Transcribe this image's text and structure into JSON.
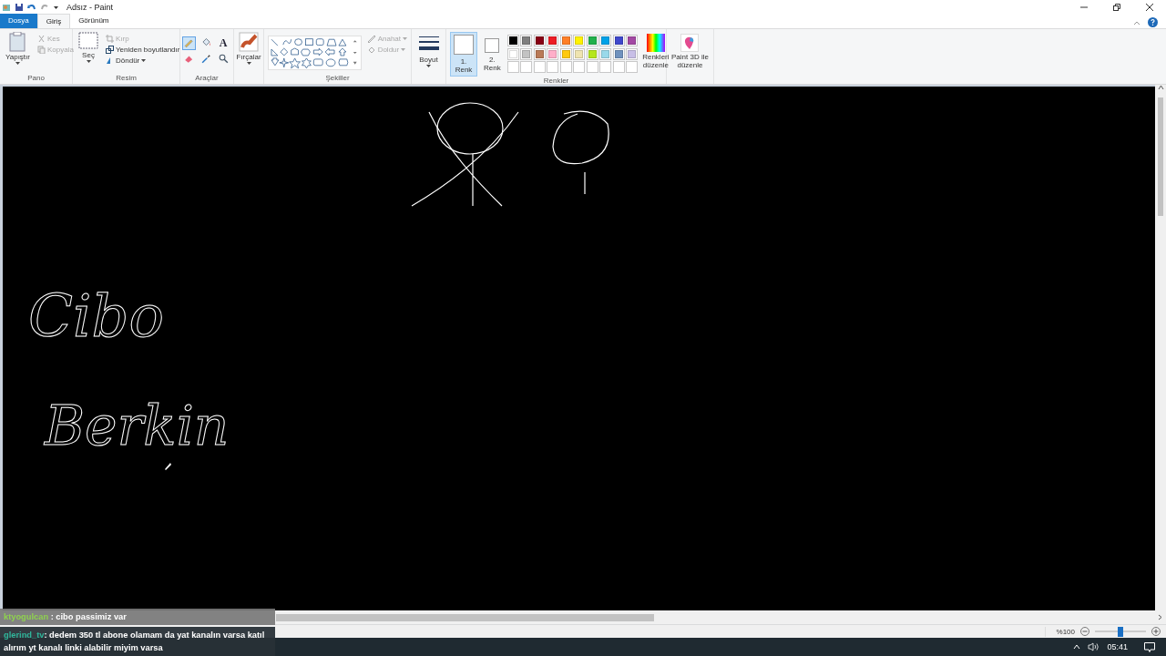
{
  "window": {
    "title": "Adsız - Paint"
  },
  "tabs": [
    {
      "label": "Dosya",
      "kind": "file",
      "selected": false
    },
    {
      "label": "Giriş",
      "kind": "tab",
      "selected": true
    },
    {
      "label": "Görünüm",
      "kind": "tab",
      "selected": false
    }
  ],
  "clipboard": {
    "label": "Pano",
    "paste": "Yapıştır",
    "cut": {
      "label": "Kes",
      "disabled": true
    },
    "copy": {
      "label": "Kopyala",
      "disabled": true
    }
  },
  "image": {
    "label": "Resim",
    "select": "Seç",
    "crop": {
      "label": "Kırp",
      "disabled": true
    },
    "resize": {
      "label": "Yeniden boyutlandır",
      "disabled": false
    },
    "rotate": {
      "label": "Döndür",
      "disabled": false
    }
  },
  "tools": {
    "label": "Araçlar",
    "items": [
      {
        "kind": "pencil",
        "selected": true
      },
      {
        "kind": "fill",
        "selected": false
      },
      {
        "kind": "text",
        "glyph": "A",
        "selected": false
      },
      {
        "kind": "eraser",
        "selected": false
      },
      {
        "kind": "picker",
        "selected": false
      },
      {
        "kind": "magnifier",
        "selected": false
      }
    ]
  },
  "brushes": "Fırçalar",
  "shapes": {
    "label": "Şekiller",
    "outline": {
      "label": "Anahat",
      "disabled": true
    },
    "fill": {
      "label": "Doldur",
      "disabled": true
    }
  },
  "size": "Boyut",
  "colors": {
    "label": "Renkler",
    "color1": {
      "label": "1. Renk",
      "color": "#ffffff",
      "selected": true
    },
    "color2": {
      "label": "2. Renk",
      "color": "#ffffff",
      "selected": false
    },
    "palette": [
      {
        "color": "#000000"
      },
      {
        "color": "#7f7f7f"
      },
      {
        "color": "#880015"
      },
      {
        "color": "#ed1c24"
      },
      {
        "color": "#ff7f27"
      },
      {
        "color": "#fff200"
      },
      {
        "color": "#22b14c"
      },
      {
        "color": "#00a2e8"
      },
      {
        "color": "#3f48cc"
      },
      {
        "color": "#a349a4"
      },
      {
        "color": "#ffffff"
      },
      {
        "color": "#c3c3c3"
      },
      {
        "color": "#b97a57"
      },
      {
        "color": "#ffaec9"
      },
      {
        "color": "#ffc90e"
      },
      {
        "color": "#efe4b0"
      },
      {
        "color": "#b5e61d"
      },
      {
        "color": "#99d9ea"
      },
      {
        "color": "#7092be"
      },
      {
        "color": "#c8bfe7"
      }
    ],
    "edit": "Renkleri düzenle"
  },
  "paint3d": "Paint 3D ile düzenle",
  "canvas": {
    "handwriting": [
      "Cibo",
      "Berkin"
    ]
  },
  "status_bar": {
    "zoom": "%100",
    "zoom_slider": {
      "level": 0.5
    }
  },
  "chat": [
    {
      "user": "ktyogulcan",
      "color": "#8fd14f",
      "text": " : cibo passimiz var"
    },
    {
      "user": "glerind_tv",
      "color": "#2fb59a",
      "text": ": dedem 350 tl abone olamam da yat kanalın varsa katıl alırım yt kanalı linki alabilir miyim varsa"
    }
  ],
  "taskbar": {
    "time": "05:41"
  }
}
